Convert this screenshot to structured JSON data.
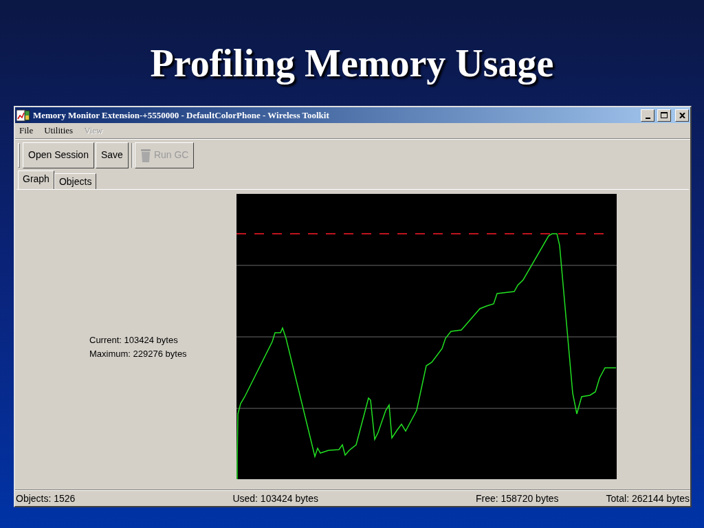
{
  "slide_title": "Profiling Memory Usage",
  "window": {
    "title": "Memory Monitor Extension-+5550000 - DefaultColorPhone - Wireless Toolkit"
  },
  "menu": [
    {
      "label": "File",
      "disabled": false
    },
    {
      "label": "Utilities",
      "disabled": false
    },
    {
      "label": "View",
      "disabled": true
    }
  ],
  "toolbar": [
    {
      "label": "Open Session",
      "kind": "text",
      "disabled": false
    },
    {
      "label": "Save",
      "kind": "text",
      "disabled": false
    },
    {
      "label": "Run GC",
      "kind": "trash",
      "disabled": true
    }
  ],
  "tabs": [
    {
      "label": "Graph",
      "selected": true
    },
    {
      "label": "Objects",
      "selected": false
    }
  ],
  "readings": [
    "Current: 103424 bytes",
    "Maximum: 229276 bytes"
  ],
  "status_bar": [
    "Objects: 1526",
    "Used: 103424 bytes",
    "Free: 158720 bytes",
    "Total: 262144 bytes"
  ]
}
